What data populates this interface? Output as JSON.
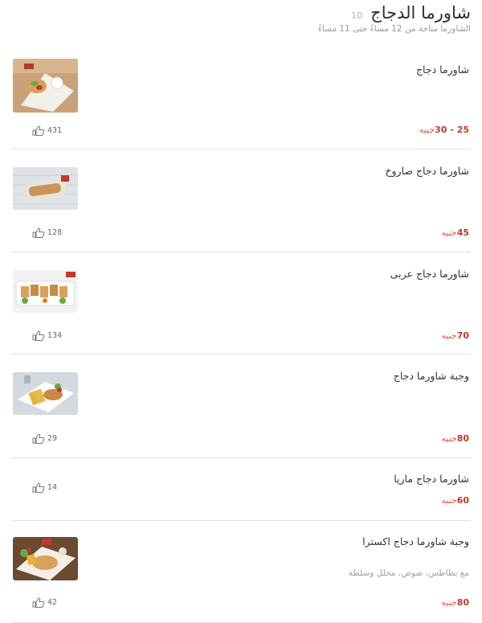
{
  "header": {
    "title": "شاورما الدجاج",
    "count": "10",
    "subtitle": "الشاورما متاحة من 12 مساءً حتى 11 مساءً"
  },
  "items": [
    {
      "name": "شاورما دجاج",
      "desc": "",
      "price_value": "25 - 30",
      "currency": "جنيه",
      "likes": "431",
      "has_image": true
    },
    {
      "name": "شاورما دجاج صاروخ",
      "desc": "",
      "price_value": "45",
      "currency": "جنيه",
      "likes": "128",
      "has_image": true
    },
    {
      "name": "شاورما دجاج عربى",
      "desc": "",
      "price_value": "70",
      "currency": "جنيه",
      "likes": "134",
      "has_image": true
    },
    {
      "name": "وجبة شاورما دجاج",
      "desc": "",
      "price_value": "80",
      "currency": "جنيه",
      "likes": "29",
      "has_image": true
    },
    {
      "name": "شاورما دجاج ماريا",
      "desc": "",
      "price_value": "60",
      "currency": "جنيه",
      "likes": "14",
      "has_image": false
    },
    {
      "name": "وجبة شاورما دجاج اكسترا",
      "desc": "مع بطاطس، صوص، مخلل وسلطة",
      "price_value": "80",
      "currency": "جنيه",
      "likes": "42",
      "has_image": true
    }
  ],
  "icons": {
    "like": "thumbs-up-icon"
  },
  "colors": {
    "price": "#c0392b",
    "divider": "#e3e3e3"
  }
}
